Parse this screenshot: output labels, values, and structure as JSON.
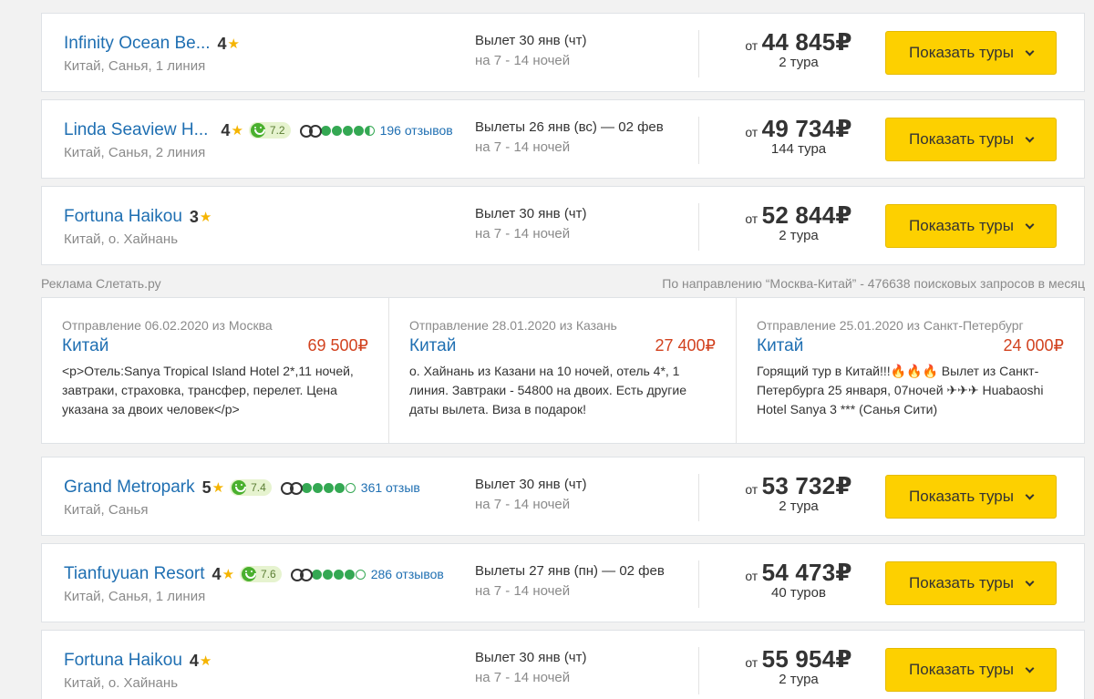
{
  "offers_top": [
    {
      "name": "Infinity Ocean Be...",
      "stars": "4",
      "location": "Китай, Санья, 1 линия",
      "departure": "Вылет 30 янв (чт)",
      "nights": "на 7 - 14 ночей",
      "from": "от",
      "price": "44 845",
      "currency": "₽",
      "tours": "2 тура",
      "button": "Показать туры"
    },
    {
      "name": "Linda Seaview H...",
      "stars": "4",
      "rating": "7.2",
      "reviews": "196 отзывов",
      "ta_score": 4.5,
      "location": "Китай, Санья, 2 линия",
      "departure": "Вылеты 26 янв (вс) — 02 фев",
      "nights": "на 7 - 14 ночей",
      "from": "от",
      "price": "49 734",
      "currency": "₽",
      "tours": "144 тура",
      "button": "Показать туры"
    },
    {
      "name": "Fortuna Haikou",
      "stars": "3",
      "location": "Китай, о. Хайнань",
      "departure": "Вылет 30 янв (чт)",
      "nights": "на 7 - 14 ночей",
      "from": "от",
      "price": "52 844",
      "currency": "₽",
      "tours": "2 тура",
      "button": "Показать туры"
    }
  ],
  "ads": {
    "label": "Реклама Слетать.ру",
    "stats": "По направлению “Москва-Китай” - 476638 поисковых запросов в месяц",
    "items": [
      {
        "departure": "Отправление 06.02.2020 из Москва",
        "destination": "Китай",
        "price": "69 500₽",
        "description": "<p>Отель:Sanya Tropical Island Hotel 2*,11 ночей, завтраки, страховка, трансфер, перелет. Цена указана за двоих человек</p>"
      },
      {
        "departure": "Отправление 28.01.2020 из Казань",
        "destination": "Китай",
        "price": "27 400₽",
        "description": "о. Хайнань из Казани на 10 ночей, отель 4*, 1 линия. Завтраки - 54800 на двоих. Есть другие даты вылета. Виза в подарок!"
      },
      {
        "departure": "Отправление 25.01.2020 из Санкт-Петербург",
        "destination": "Китай",
        "price": "24 000₽",
        "description": "Горящий тур в Китай!!!🔥🔥🔥 Вылет из Санкт-Петербурга 25 января, 07ночей ✈✈✈ Huabaoshi Hotel Sanya 3 *** (Санья Сити)"
      }
    ]
  },
  "offers_bottom": [
    {
      "name": "Grand Metropark",
      "stars": "5",
      "rating": "7.4",
      "reviews": "361 отзыв",
      "ta_score": 4,
      "location": "Китай, Санья",
      "departure": "Вылет 30 янв (чт)",
      "nights": "на 7 - 14 ночей",
      "from": "от",
      "price": "53 732",
      "currency": "₽",
      "tours": "2 тура",
      "button": "Показать туры"
    },
    {
      "name": "Tianfuyuan Resort",
      "stars": "4",
      "rating": "7.6",
      "reviews": "286 отзывов",
      "ta_score": 4,
      "location": "Китай, Санья, 1 линия",
      "departure": "Вылеты 27 янв (пн) — 02 фев",
      "nights": "на 7 - 14 ночей",
      "from": "от",
      "price": "54 473",
      "currency": "₽",
      "tours": "40 туров",
      "button": "Показать туры"
    },
    {
      "name": "Fortuna Haikou",
      "stars": "4",
      "location": "Китай, о. Хайнань",
      "departure": "Вылет 30 янв (чт)",
      "nights": "на 7 - 14 ночей",
      "from": "от",
      "price": "55 954",
      "currency": "₽",
      "tours": "2 тура",
      "button": "Показать туры"
    }
  ],
  "colors": {
    "link": "#1f6fb2",
    "button": "#fdd000",
    "ad_price": "#d2421f",
    "rating_green": "#4ab02e"
  }
}
